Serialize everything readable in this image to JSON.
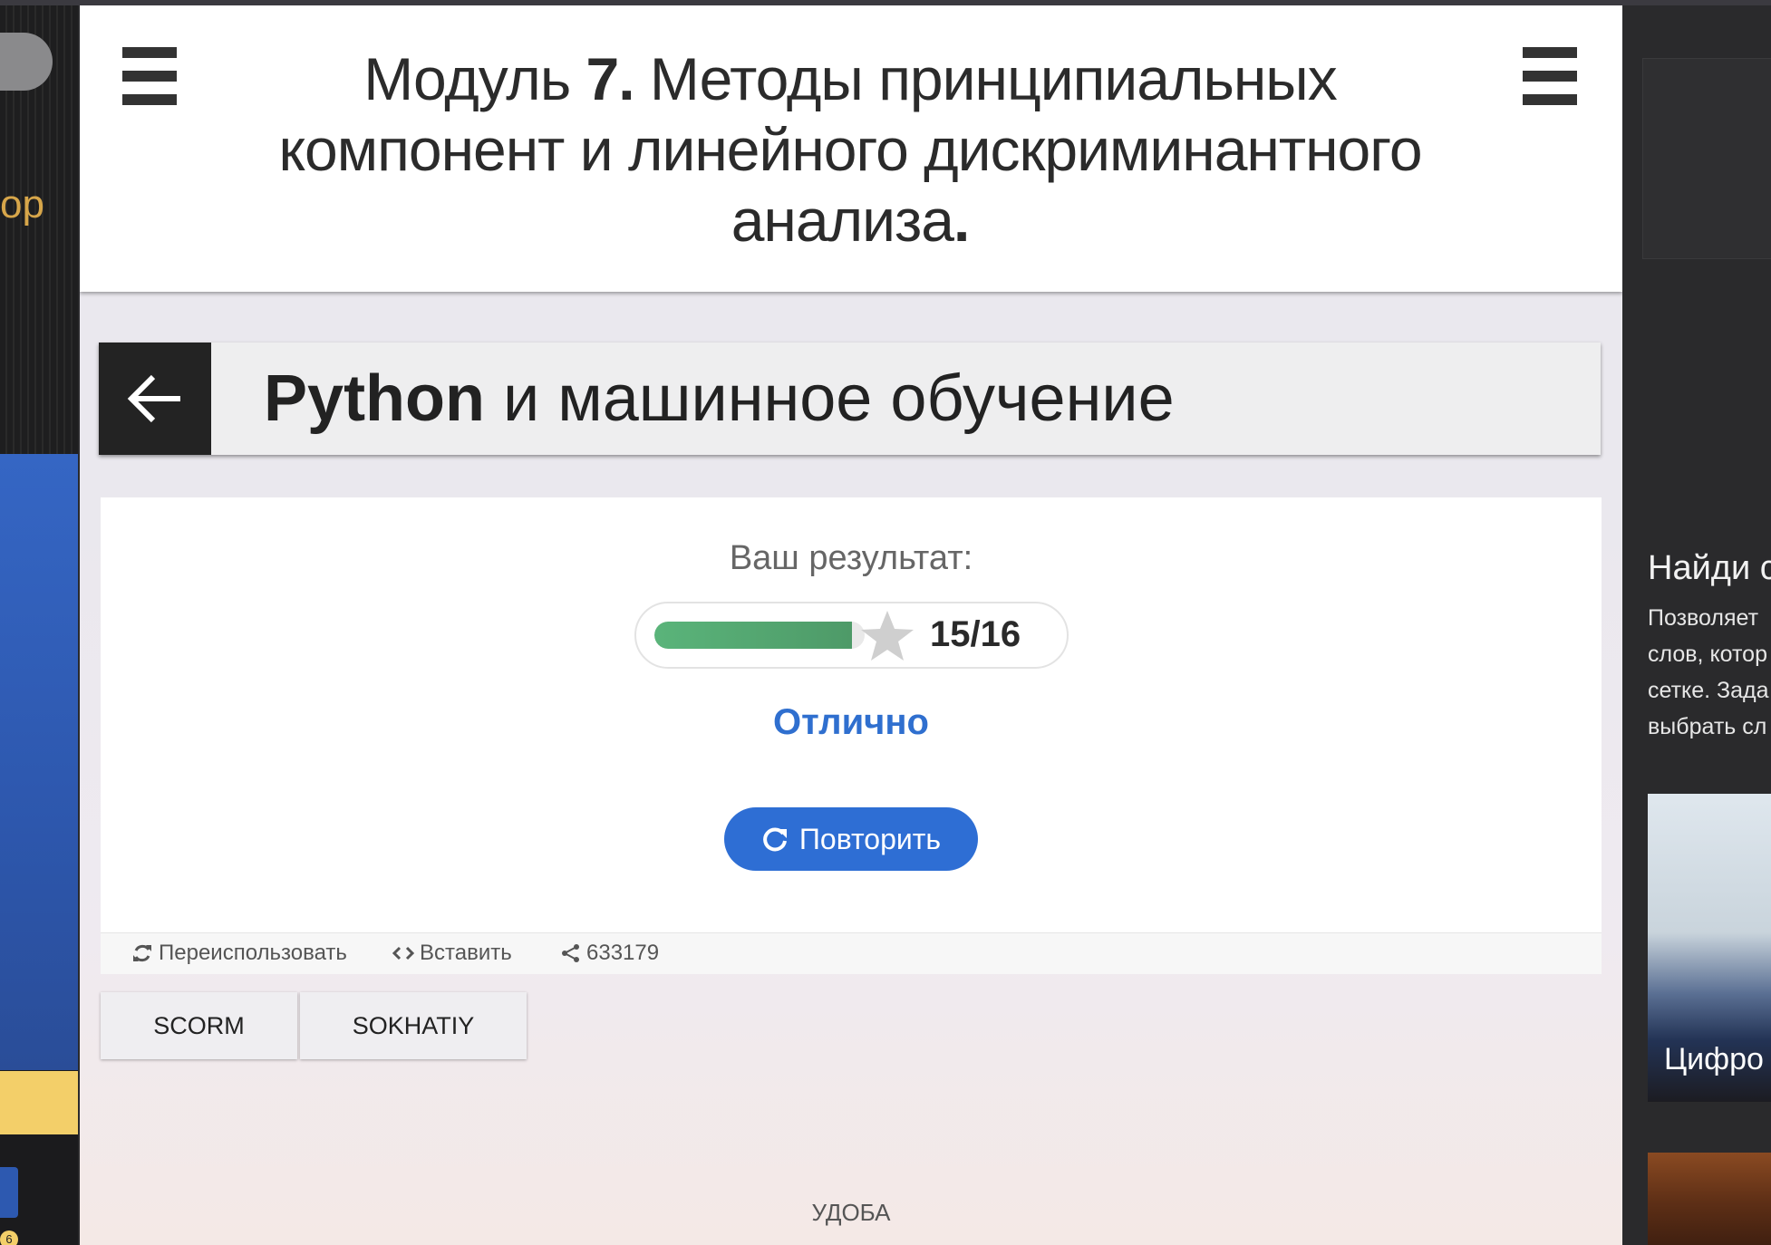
{
  "header": {
    "module_title_prefix": "Модуль ",
    "module_number": "7.",
    "module_title_rest": " Методы принципиальных компонент и линейного дискриминантного анализа",
    "module_title_end": "."
  },
  "course": {
    "title_bold": "Python",
    "title_rest": " и машинное обучение"
  },
  "result": {
    "label": "Ваш результат:",
    "score_text": "15/16",
    "score_fraction": 0.9375,
    "grade": "Отлично",
    "retry_label": "Повторить"
  },
  "actions": {
    "reuse_label": "Переиспользовать",
    "embed_label": "Вставить",
    "share_count": "633179"
  },
  "export": {
    "scorm_label": "SCORM",
    "sokhatiy_label": "SOKHATIY"
  },
  "footer": {
    "text": "УДОБА"
  },
  "left_panel": {
    "gold_text": "ор",
    "badge": "6"
  },
  "right_panel": {
    "heading": "Найди с",
    "desc_lines": [
      "Позволяет",
      "слов, котор",
      "сетке. Зада",
      "выбрать сл"
    ],
    "image_caption": "Цифро"
  },
  "colors": {
    "accent_blue": "#2e6ed4",
    "grade_blue": "#2f6fcf",
    "progress_green": "#5ab47a",
    "header_dark": "#232323"
  },
  "icons": {
    "menu": "hamburger-icon",
    "back": "arrow-left-icon",
    "star": "star-icon",
    "retry": "refresh-icon",
    "reuse": "sync-icon",
    "embed": "code-icon",
    "share": "share-icon"
  }
}
